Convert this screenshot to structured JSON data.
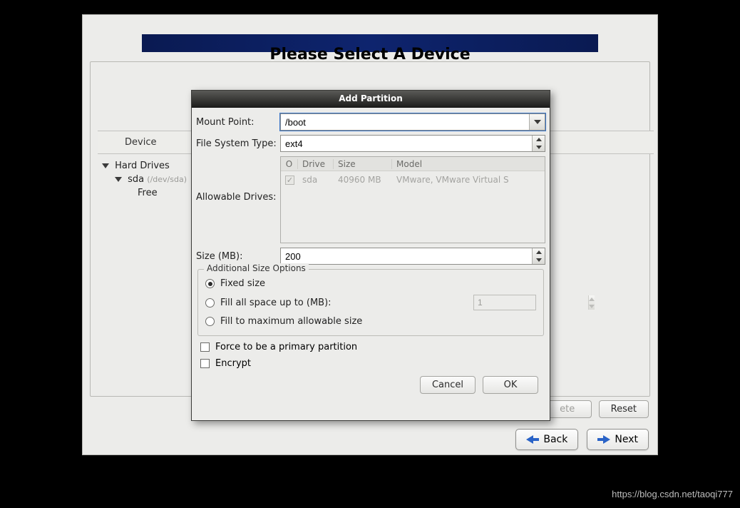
{
  "banner": {},
  "main_title": "Please Select A Device",
  "tree": {
    "header": "Device",
    "hard_drives": "Hard Drives",
    "sda": "sda",
    "sda_path": "(/dev/sda)",
    "free": "Free"
  },
  "buttons": {
    "delete": "ete",
    "reset": "Reset",
    "back": "Back",
    "next": "Next"
  },
  "dialog": {
    "title": "Add Partition",
    "labels": {
      "mount_point": "Mount Point:",
      "fs_type": "File System Type:",
      "allowable_drives": "Allowable Drives:",
      "size": "Size (MB):"
    },
    "values": {
      "mount_point": "/boot",
      "fs_type": "ext4",
      "size": "200"
    },
    "drives_columns": {
      "o": "O",
      "drive": "Drive",
      "size": "Size",
      "model": "Model"
    },
    "drives": [
      {
        "checked": true,
        "name": "sda",
        "size": "40960 MB",
        "model": "VMware, VMware Virtual S"
      }
    ],
    "size_options": {
      "group_title": "Additional Size Options",
      "fixed": "Fixed size",
      "fill_up_to": "Fill all space up to (MB):",
      "fill_up_to_value": "1",
      "fill_max": "Fill to maximum allowable size",
      "selected": "fixed"
    },
    "checks": {
      "primary": "Force to be a primary partition",
      "encrypt": "Encrypt"
    },
    "actions": {
      "cancel": "Cancel",
      "ok": "OK"
    }
  },
  "watermark": "https://blog.csdn.net/taoqi777"
}
